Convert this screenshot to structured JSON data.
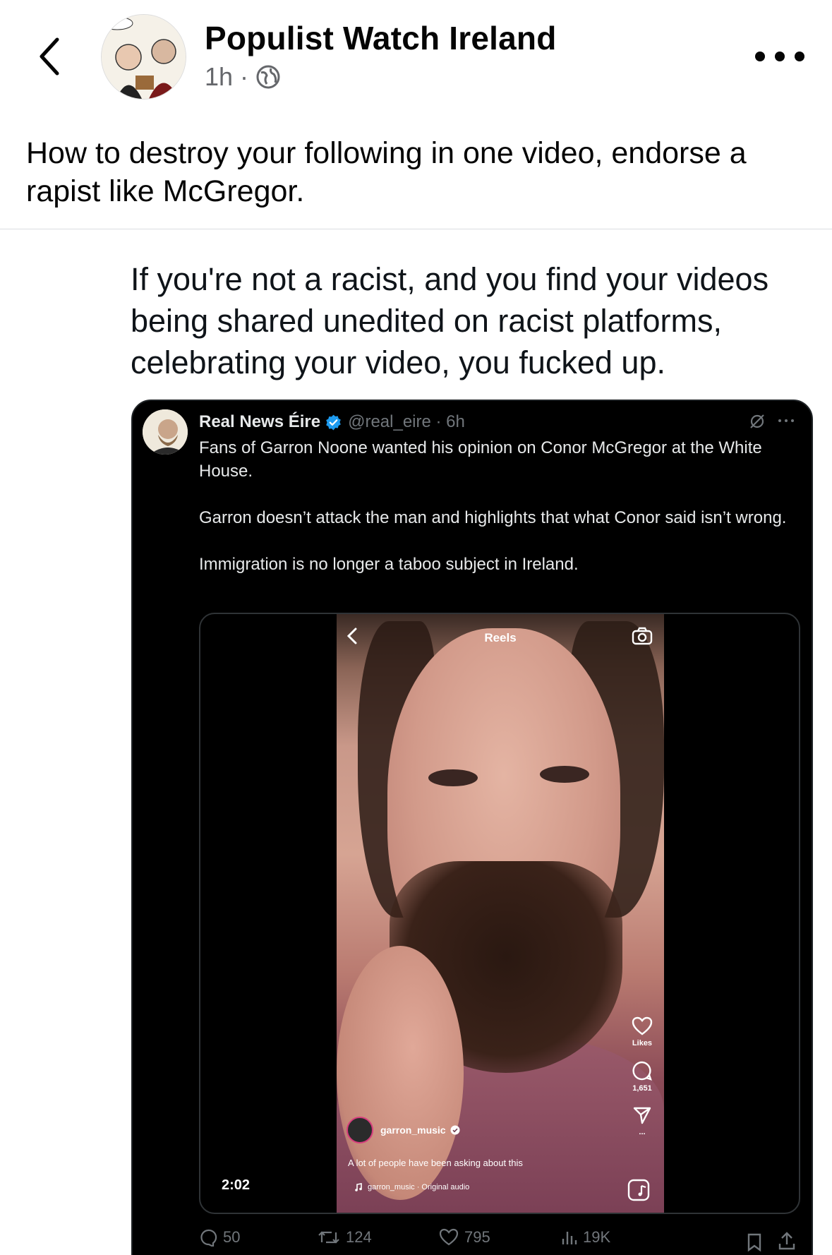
{
  "header": {
    "page_name": "Populist Watch Ireland",
    "time": "1h",
    "separator": "·",
    "back_icon": "chevron-left-icon",
    "privacy_icon": "globe-icon",
    "more_icon": "more-horizontal-icon"
  },
  "post": {
    "caption": "How to destroy your following in one video, endorse a rapist like McGregor.",
    "quote_text": "If you're not a racist, and you find your videos being shared unedited on racist platforms, celebrating your video, you fucked up."
  },
  "tweet": {
    "name": "Real News Éire",
    "handle": "@real_eire · 6h",
    "verified_color": "#1d9bf0",
    "paragraphs": [
      "Fans of Garron Noone wanted his opinion on Conor McGregor at the White House.",
      "Garron doesn’t attack the man and highlights that what Conor said isn’t wrong.",
      "Immigration is no longer a taboo subject in Ireland."
    ],
    "video": {
      "duration": "2:02",
      "reels_title": "Reels",
      "likes_label": "Likes",
      "comments_count": "1,651",
      "more": "...",
      "username": "garron_music",
      "caption": "A lot of people have been asking about this",
      "audio": "garron_music · Original audio"
    },
    "actions": {
      "replies": "50",
      "retweets": "124",
      "likes": "795",
      "views": "19K"
    }
  },
  "colors": {
    "text": "#050505",
    "secondary": "#65676b",
    "tweet_bg": "#000000",
    "tweet_text": "#e7e9ea",
    "tweet_muted": "#71767b"
  }
}
